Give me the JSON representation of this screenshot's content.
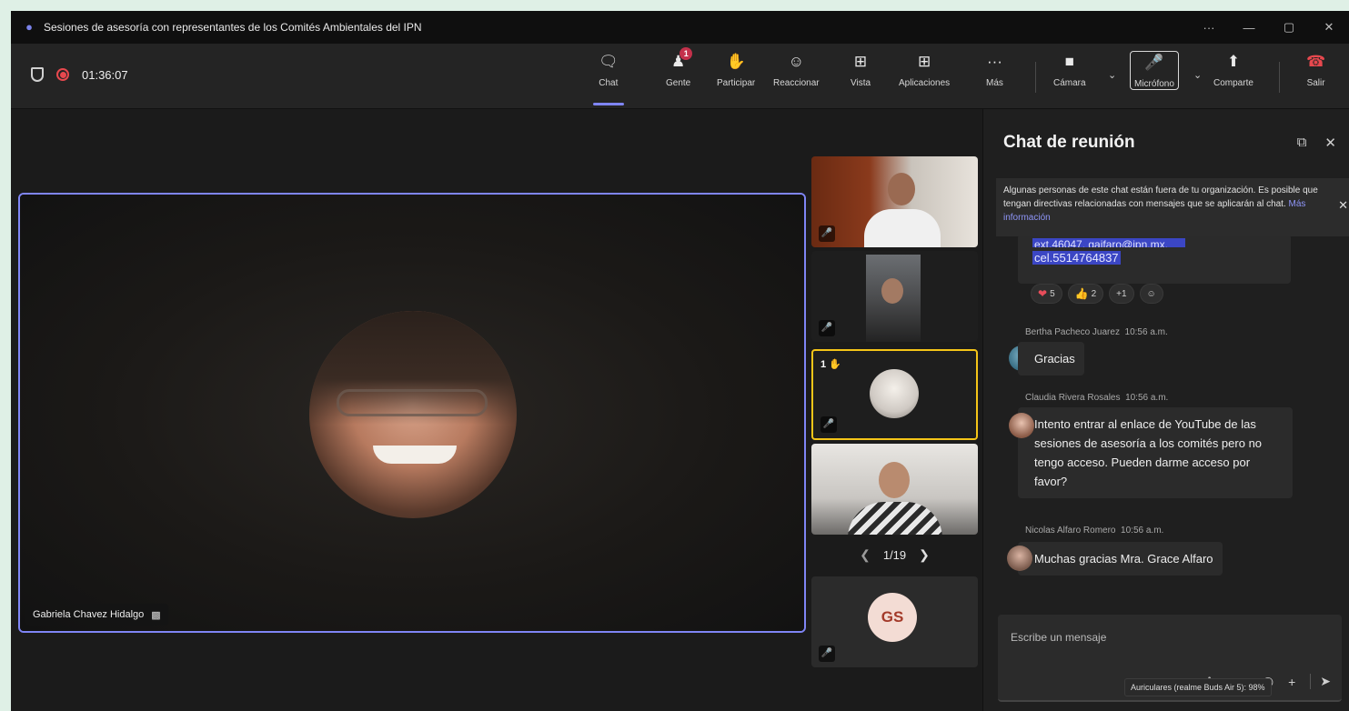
{
  "window": {
    "title": "Sesiones de asesoría con representantes de los Comités Ambientales del IPN",
    "controls": [
      "···",
      "—",
      "▢",
      "✕"
    ]
  },
  "meeting": {
    "timer": "01:36:07"
  },
  "toolbar": {
    "items": [
      {
        "label": "Chat",
        "icon": "chat-icon"
      },
      {
        "label": "Gente",
        "icon": "people-icon",
        "badge": "1"
      },
      {
        "label": "Participar",
        "icon": "raise-hand-icon"
      },
      {
        "label": "Reaccionar",
        "icon": "smiley-icon"
      },
      {
        "label": "Vista",
        "icon": "grid-view-icon"
      },
      {
        "label": "Aplicaciones",
        "icon": "apps-icon"
      },
      {
        "label": "Más",
        "icon": "more-icon"
      },
      {
        "label": "Cámara",
        "icon": "camera-off-icon"
      },
      {
        "label": "Micrófono",
        "icon": "mic-off-icon"
      },
      {
        "label": "Comparte",
        "icon": "share-icon"
      },
      {
        "label": "Salir",
        "icon": "hangup-icon"
      }
    ]
  },
  "stage": {
    "speaker_name": "Gabriela Chavez Hidalgo"
  },
  "gallery": {
    "pager": "1/19",
    "raised_hand_count": "1",
    "initials": "GS"
  },
  "chat": {
    "title": "Chat de reunión",
    "notice_text": "Algunas personas de este chat están fuera de tu organización. Es posible que tengan directivas relacionadas con mensajes que se aplicarán al chat.",
    "notice_link": "Más información",
    "cut_message_line1": "ext.46047, gaifaro@ipn.mx,",
    "cut_message_line2": "cel.5514764837",
    "reactions": [
      {
        "icon": "heart-icon",
        "count": "5"
      },
      {
        "icon": "thumbs-up-icon",
        "count": "2"
      },
      {
        "label": "+1"
      }
    ],
    "messages": [
      {
        "author": "Bertha Pacheco Juarez",
        "time": "10:56 a.m.",
        "text": "Gracias"
      },
      {
        "author": "Claudia Rivera Rosales",
        "time": "10:56 a.m.",
        "text": "Intento entrar al enlace de YouTube de las sesiones de asesoría a los comités pero no tengo acceso. Pueden darme acceso por favor?"
      },
      {
        "author": "Nicolas Alfaro Romero",
        "time": "10:56 a.m.",
        "text": "Muchas gracias Mra. Grace Alfaro"
      }
    ],
    "compose_placeholder": "Escribe un mensaje",
    "tooltip": "Auriculares (realme Buds Air 5): 98%"
  },
  "colors": {
    "accent": "#7f85f5",
    "record": "#e7484e",
    "raised_hand": "#f5c518",
    "badge": "#c4314b"
  }
}
